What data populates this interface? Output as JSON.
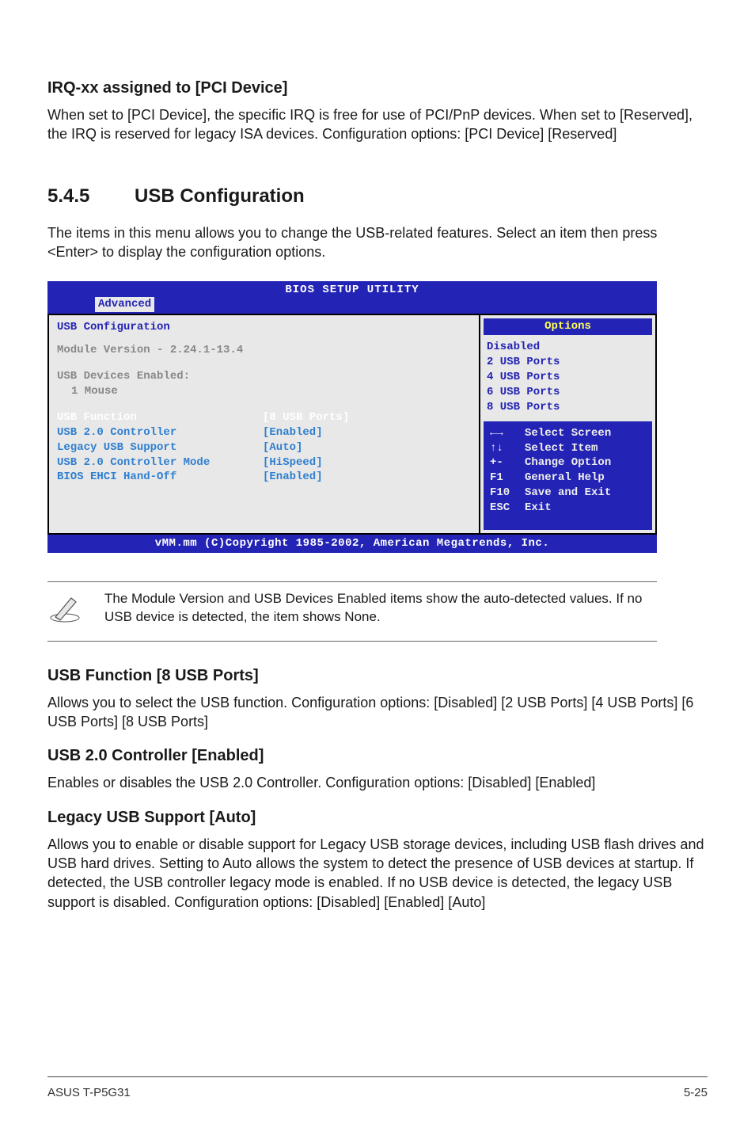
{
  "s1": {
    "title": "IRQ-xx assigned to [PCI Device]",
    "p1": "When set to [PCI Device], the specific IRQ is free for use of PCI/PnP devices. When set to [Reserved], the IRQ is reserved for legacy ISA devices. Configuration options: [PCI Device] [Reserved]"
  },
  "sec": {
    "num": "5.4.5",
    "title": "USB Configuration"
  },
  "intro": "The items in this menu allows you to change the USB-related features. Select an item then press <Enter> to display the configuration options.",
  "bios": {
    "title": "BIOS SETUP UTILITY",
    "tab": "Advanced",
    "left_head": "USB Configuration",
    "module": "Module Version - 2.24.1-13.4",
    "dev_h": "USB Devices Enabled:",
    "dev_1": "1 Mouse",
    "rows": {
      "r0l": "USB Function",
      "r0v": "[8 USB Ports]",
      "r1l": "USB 2.0 Controller",
      "r1v": "[Enabled]",
      "r2l": "Legacy USB Support",
      "r2v": "[Auto]",
      "r3l": "USB 2.0 Controller Mode",
      "r3v": "[HiSpeed]",
      "r4l": "BIOS EHCI Hand-Off",
      "r4v": "[Enabled]"
    },
    "opt_head": "Options",
    "opts": {
      "o0": "Disabled",
      "o1": "2 USB Ports",
      "o2": "4 USB Ports",
      "o3": "6 USB Ports",
      "o4": "8 USB Ports"
    },
    "keys": {
      "k0": "←→",
      "k0t": "Select Screen",
      "k1": "↑↓",
      "k1t": "Select Item",
      "k2": "+-",
      "k2t": "Change Option",
      "k3": "F1",
      "k3t": "General Help",
      "k4": "F10",
      "k4t": "Save and Exit",
      "k5": "ESC",
      "k5t": "Exit"
    },
    "foot": "vMM.mm (C)Copyright 1985-2002, American Megatrends, Inc."
  },
  "note": "The Module Version and USB Devices Enabled items show the auto-detected values. If no USB device is detected, the item shows None.",
  "s2": {
    "title": "USB Function [8 USB Ports]",
    "p": "Allows you to select the USB function. Configuration options: [Disabled] [2 USB Ports] [4 USB Ports] [6 USB Ports] [8 USB Ports]"
  },
  "s3": {
    "title": "USB 2.0 Controller [Enabled]",
    "p": "Enables or disables the USB 2.0 Controller. Configuration options: [Disabled] [Enabled]"
  },
  "s4": {
    "title": "Legacy USB Support [Auto]",
    "p": "Allows you to enable or disable support for Legacy USB storage devices, including USB flash drives and USB hard drives. Setting to Auto allows the system to detect the presence of USB devices at startup. If detected, the USB controller legacy mode is enabled. If no USB device is detected, the legacy USB support is disabled. Configuration options: [Disabled] [Enabled] [Auto]"
  },
  "footer": {
    "left": "ASUS T-P5G31",
    "right": "5-25"
  }
}
